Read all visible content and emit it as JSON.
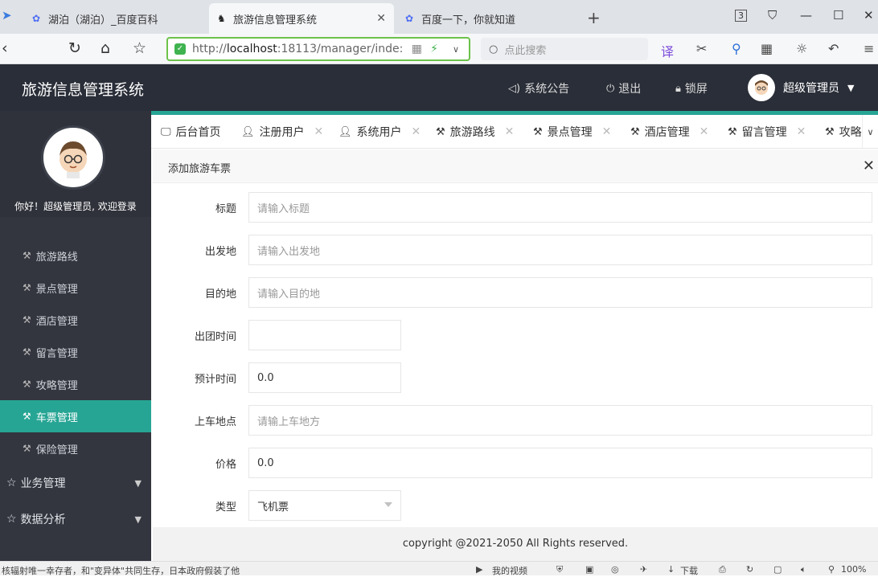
{
  "browser": {
    "tabs": [
      {
        "title": "湖泊（湖泊）_百度百科",
        "active": false
      },
      {
        "title": "旅游信息管理系统",
        "active": true
      },
      {
        "title": "百度一下，你就知道",
        "active": false
      }
    ],
    "url_prefix": "http://",
    "url_host": "localhost",
    "url_rest": ":18113/manager/inde:",
    "search_placeholder": "点此搜索",
    "tab_count": "3"
  },
  "header": {
    "title": "旅游信息管理系统",
    "links": [
      {
        "label": "系统公告",
        "icon": "speaker-icon"
      },
      {
        "label": "退出",
        "icon": "power-icon"
      },
      {
        "label": "锁屏",
        "icon": "lock-icon"
      }
    ],
    "user_name": "超级管理员"
  },
  "sidebar": {
    "welcome": "你好！超级管理员, 欢迎登录",
    "items": [
      {
        "label": "旅游路线",
        "active": false
      },
      {
        "label": "景点管理",
        "active": false
      },
      {
        "label": "酒店管理",
        "active": false
      },
      {
        "label": "留言管理",
        "active": false
      },
      {
        "label": "攻略管理",
        "active": false
      },
      {
        "label": "车票管理",
        "active": true
      },
      {
        "label": "保险管理",
        "active": false
      }
    ],
    "groups": [
      {
        "label": "业务管理"
      },
      {
        "label": "数据分析"
      }
    ]
  },
  "content_tabs": [
    {
      "label": "后台首页",
      "icon": "monitor-icon",
      "closable": false
    },
    {
      "label": "注册用户",
      "icon": "user-icon",
      "closable": true
    },
    {
      "label": "系统用户",
      "icon": "user-icon",
      "closable": true
    },
    {
      "label": "旅游路线",
      "icon": "wrench-icon",
      "closable": true
    },
    {
      "label": "景点管理",
      "icon": "wrench-icon",
      "closable": true
    },
    {
      "label": "酒店管理",
      "icon": "wrench-icon",
      "closable": true
    },
    {
      "label": "留言管理",
      "icon": "wrench-icon",
      "closable": true
    },
    {
      "label": "攻略",
      "icon": "wrench-icon",
      "closable": false
    }
  ],
  "panel": {
    "title": "添加旅游车票"
  },
  "form": {
    "fields": [
      {
        "label": "标题",
        "value": "",
        "placeholder": "请输入标题"
      },
      {
        "label": "出发地",
        "value": "",
        "placeholder": "请输入出发地"
      },
      {
        "label": "目的地",
        "value": "",
        "placeholder": "请输入目的地"
      },
      {
        "label": "出团时间",
        "value": "",
        "placeholder": ""
      },
      {
        "label": "预计时间",
        "value": "0.0",
        "placeholder": ""
      },
      {
        "label": "上车地点",
        "value": "",
        "placeholder": "请输上车地方"
      },
      {
        "label": "价格",
        "value": "0.0",
        "placeholder": ""
      },
      {
        "label": "类型",
        "value": "飞机票",
        "placeholder": ""
      }
    ]
  },
  "footer": {
    "copyright": "copyright @2021-2050 All Rights reserved."
  },
  "statusbar": {
    "news": "核辐射唯一幸存者，和\"变异体\"共同生存，日本政府假装了他",
    "video": "我的视频",
    "download": "下载",
    "zoom": "100%"
  }
}
